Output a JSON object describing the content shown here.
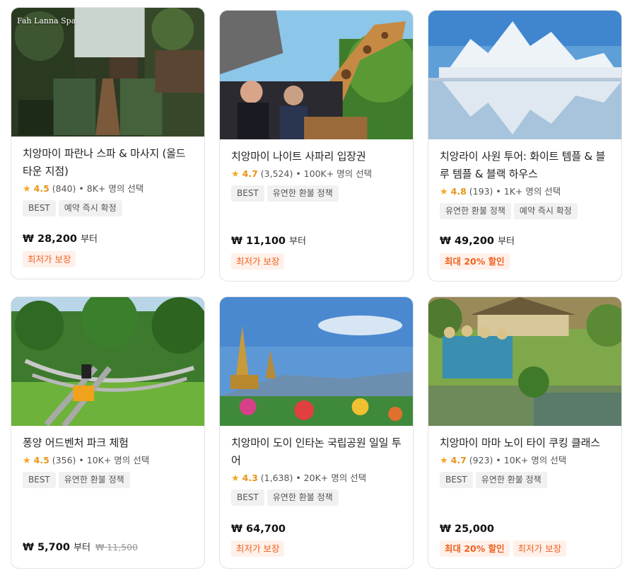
{
  "cards": [
    {
      "overlay": "Fah Lanna Spa",
      "title": "치앙마이 파란나 스파 & 마사지 (올드 타운 지점)",
      "score": "4.5",
      "count": "(840)",
      "booked": "• 8K+ 명의 선택",
      "tags": [
        "BEST",
        "예약 즉시 확정"
      ],
      "price": "₩ 28,200",
      "price_suffix": "부터",
      "orig_price": "",
      "promos": [
        "최저가 보장"
      ]
    },
    {
      "overlay": "",
      "title": "치앙마이 나이트 사파리 입장권",
      "score": "4.7",
      "count": "(3,524)",
      "booked": "• 100K+ 명의 선택",
      "tags": [
        "BEST",
        "유연한 환불 정책"
      ],
      "price": "₩ 11,100",
      "price_suffix": "부터",
      "orig_price": "",
      "promos": [
        "최저가 보장"
      ]
    },
    {
      "overlay": "",
      "title": "치앙라이 사원 투어: 화이트 템플 & 블루 템플 & 블랙 하우스",
      "score": "4.8",
      "count": "(193)",
      "booked": "• 1K+ 명의 선택",
      "tags": [
        "유연한 환불 정책",
        "예약 즉시 확정"
      ],
      "price": "₩ 49,200",
      "price_suffix": "부터",
      "orig_price": "",
      "promos": [
        "최대 20% 할인"
      ]
    },
    {
      "overlay": "",
      "title": "퐁양 어드벤처 파크 체험",
      "score": "4.5",
      "count": "(356)",
      "booked": "• 10K+ 명의 선택",
      "tags": [
        "BEST",
        "유연한 환불 정책"
      ],
      "price": "₩ 5,700",
      "price_suffix": "부터",
      "orig_price": "₩ 11,500",
      "promos": []
    },
    {
      "overlay": "",
      "title": "치앙마이 도이 인타논 국립공원 일일 투어",
      "score": "4.3",
      "count": "(1,638)",
      "booked": "• 20K+ 명의 선택",
      "tags": [
        "BEST",
        "유연한 환불 정책"
      ],
      "price": "₩ 64,700",
      "price_suffix": "",
      "orig_price": "",
      "promos": [
        "최저가 보장"
      ]
    },
    {
      "overlay": "",
      "title": "치앙마이 마마 노이 타이 쿠킹 클래스",
      "score": "4.7",
      "count": "(923)",
      "booked": "• 10K+ 명의 선택",
      "tags": [
        "BEST",
        "유연한 환불 정책"
      ],
      "price": "₩ 25,000",
      "price_suffix": "",
      "orig_price": "",
      "promos": [
        "최대 20% 할인",
        "최저가 보장"
      ]
    }
  ],
  "star_glyph": "★",
  "colors": {
    "star": "#f5a623",
    "promo_text": "#f0621f",
    "promo_bg": "#fff0ea"
  }
}
